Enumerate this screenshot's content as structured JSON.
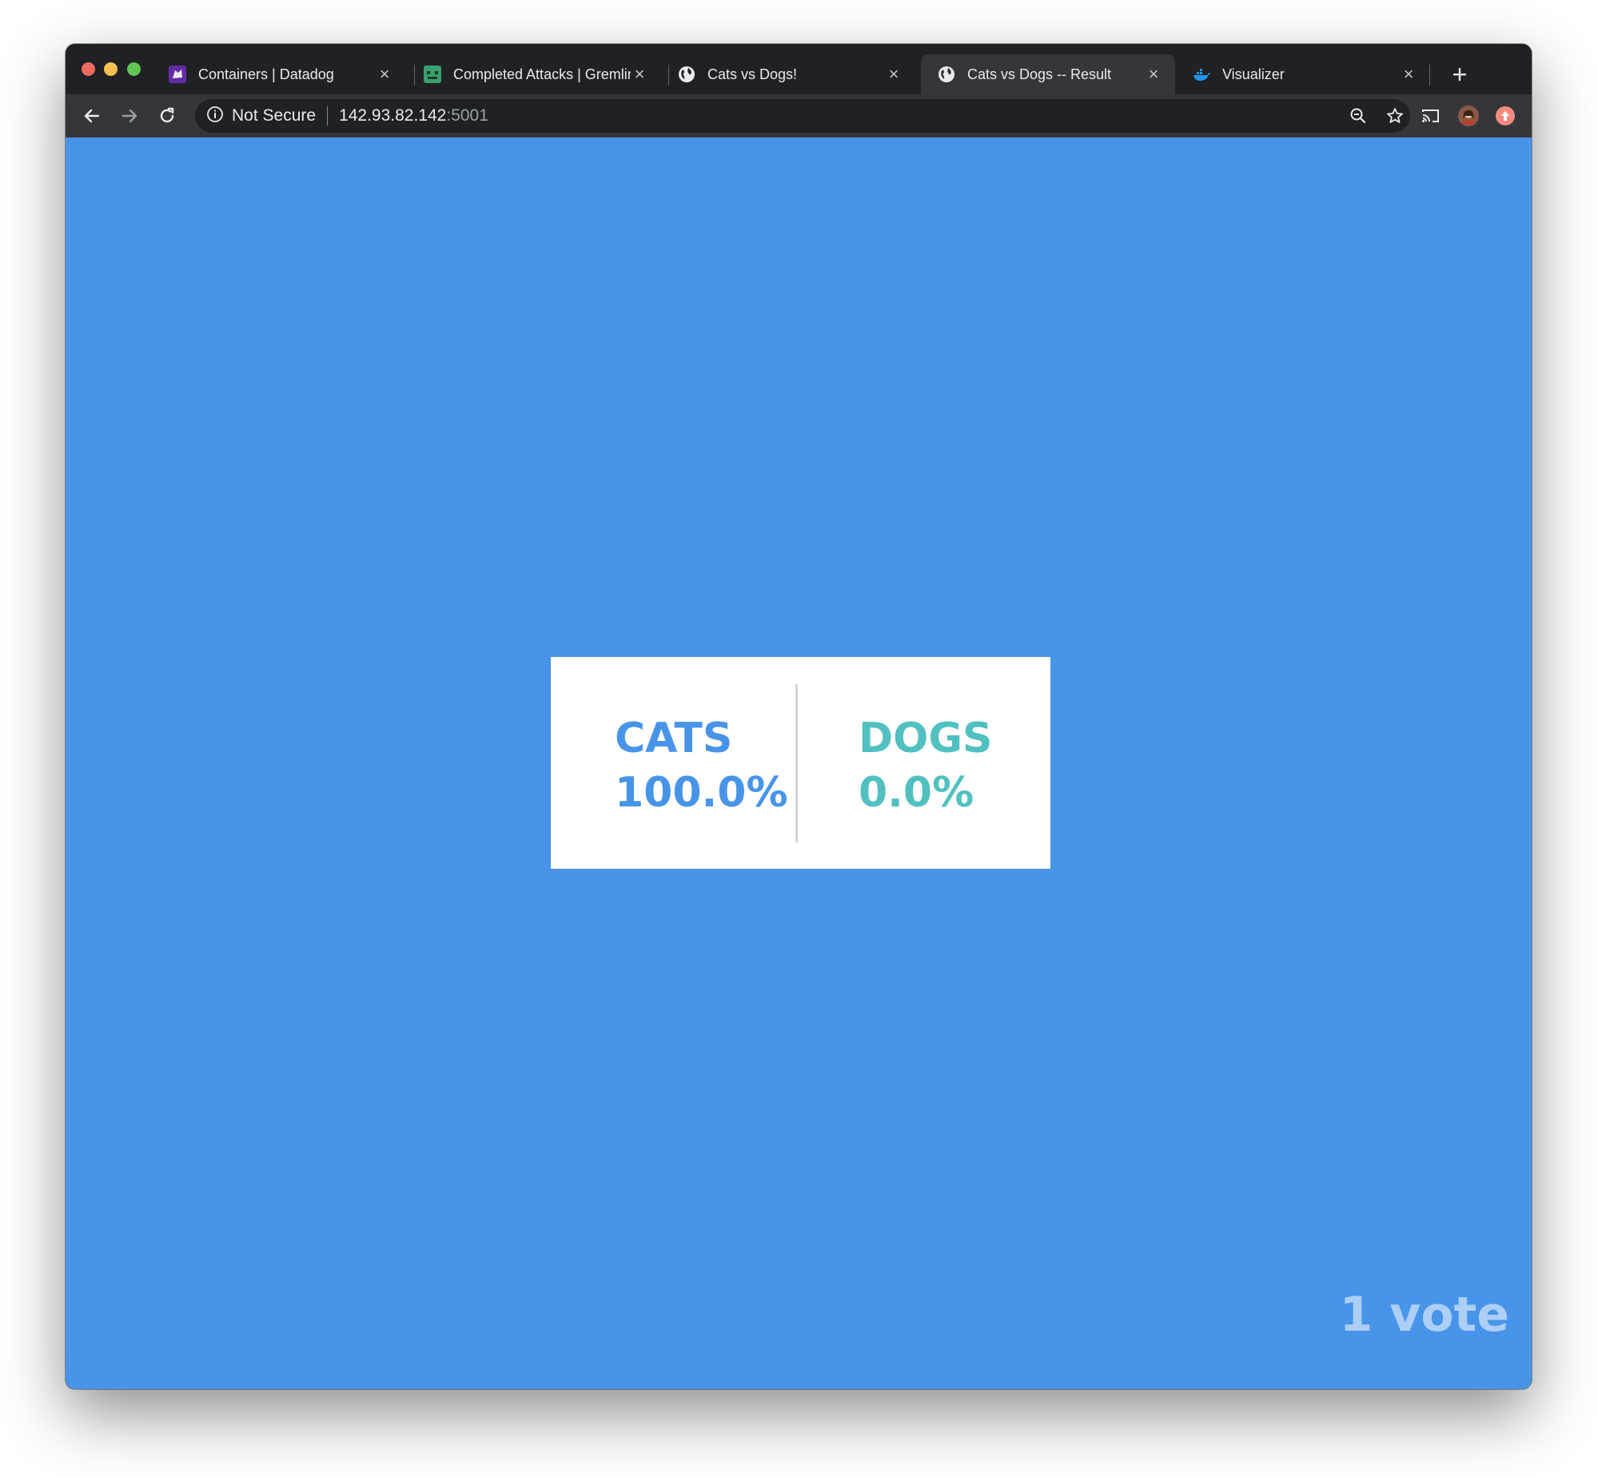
{
  "browser": {
    "tabs": [
      {
        "title": "Containers | Datadog",
        "favicon": "datadog-icon",
        "active": false
      },
      {
        "title": "Completed Attacks | Gremlin",
        "favicon": "gremlin-icon",
        "active": false
      },
      {
        "title": "Cats vs Dogs!",
        "favicon": "globe-icon",
        "active": false
      },
      {
        "title": "Cats vs Dogs -- Result",
        "favicon": "globe-icon",
        "active": true
      },
      {
        "title": "Visualizer",
        "favicon": "docker-icon",
        "active": false
      }
    ],
    "address": {
      "security_label": "Not Secure",
      "host": "142.93.82.142",
      "port": ":5001"
    },
    "colors": {
      "frame": "#202124",
      "toolbar": "#35363a"
    }
  },
  "page": {
    "background": "#4894e8",
    "results": {
      "option_a": {
        "name": "CATS",
        "percent": "100.0%",
        "color": "#4894e8"
      },
      "option_b": {
        "name": "DOGS",
        "percent": "0.0%",
        "color": "#51c0c0"
      }
    },
    "vote_count": "1 vote"
  }
}
